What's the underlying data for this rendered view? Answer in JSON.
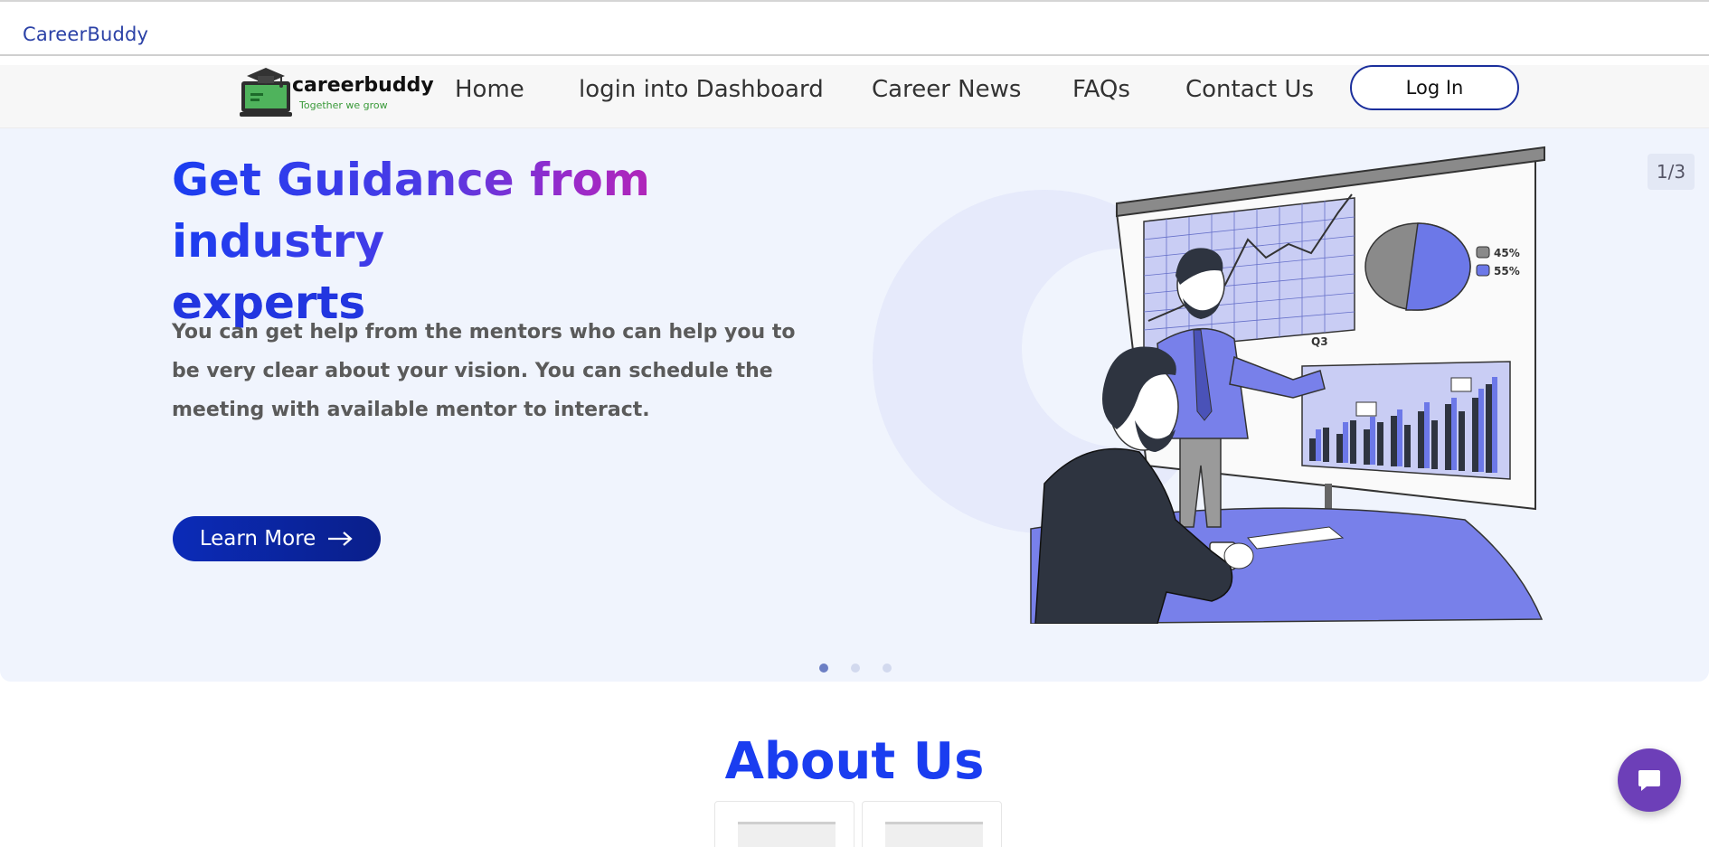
{
  "topbar": {
    "brand": "CareerBuddy"
  },
  "logo": {
    "name": "careerbuddy",
    "tagline": "Together we grow"
  },
  "nav": {
    "links": [
      "Home",
      "login into Dashboard",
      "Career News",
      "FAQs",
      "Contact Us"
    ],
    "login_label": "Log In"
  },
  "hero": {
    "title_line1": "Get Guidance from industry",
    "title_line2": "experts",
    "description": "You can get help from the mentors who can help you to be very clear about your vision. You can schedule the meeting with available mentor to interact.",
    "cta_label": "Learn More",
    "slide_counter": "1/3",
    "active_slide": 1,
    "slide_count": 3,
    "illustration": {
      "pie_labels": [
        "45%",
        "55%"
      ],
      "chart_label": "Q3"
    }
  },
  "about": {
    "title": "About Us"
  },
  "colors": {
    "brand_blue": "#1a3df0",
    "brand_pink": "#d21ea0",
    "cta_blue": "#0b2bb8",
    "chat_purple": "#6d3fb8"
  },
  "icons": {
    "cta": "arrow-right-icon",
    "chat": "chat-bubble-icon"
  }
}
